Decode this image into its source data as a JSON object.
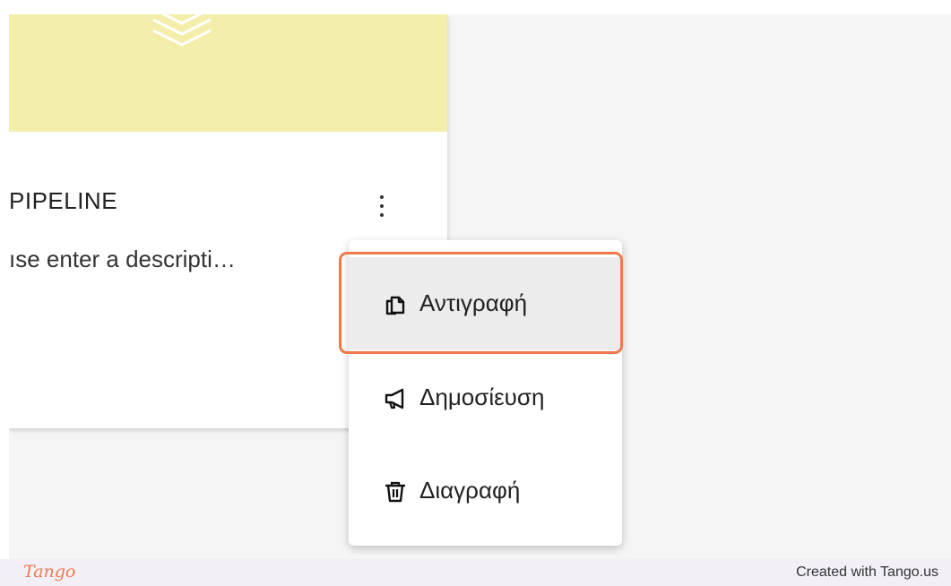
{
  "card": {
    "title": "PIPELINE",
    "description": "ıse enter a descripti…",
    "banner_color": "#f3eeaa"
  },
  "menu": {
    "items": [
      {
        "label": "Αντιγραφή",
        "icon": "copy-icon",
        "highlighted": true
      },
      {
        "label": "Δημοσίευση",
        "icon": "megaphone-icon",
        "highlighted": false
      },
      {
        "label": "Διαγραφή",
        "icon": "trash-icon",
        "highlighted": false
      }
    ],
    "highlight_color": "#f27a4a"
  },
  "footer": {
    "logo": "Tango",
    "credit": "Created with Tango.us"
  }
}
